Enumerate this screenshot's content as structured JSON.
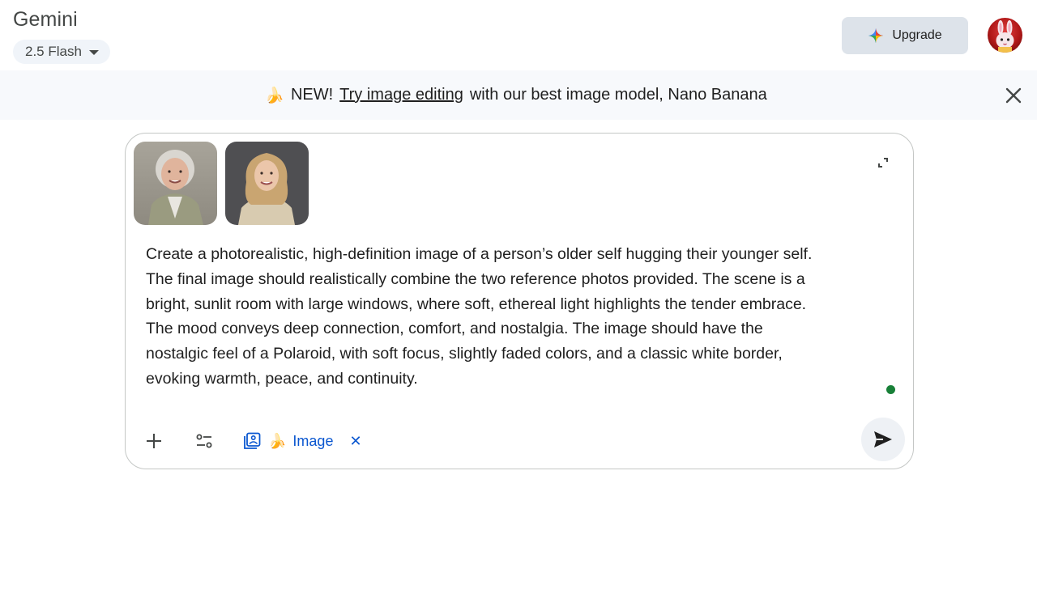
{
  "header": {
    "app_title": "Gemini",
    "model_label": "2.5 Flash",
    "upgrade_label": "Upgrade"
  },
  "banner": {
    "emoji": "🍌",
    "prefix": "NEW!",
    "link_text": "Try image editing",
    "suffix": "with our best image model, Nano Banana"
  },
  "composer": {
    "prompt": "Create a photorealistic, high-definition image of a person’s older self hugging their younger self.\nThe final image should realistically combine the two reference photos provided. The scene is a\nbright, sunlit room with large windows, where soft, ethereal light highlights the tender embrace.\nThe mood conveys deep connection, comfort, and nostalgia. The image should have the\nnostalgic feel of a Polaroid, with soft focus, slightly faded colors, and a classic white border,\nevoking warmth, peace, and continuity.",
    "chip_emoji": "🍌",
    "chip_label": "Image",
    "chip_close": "✕"
  },
  "colors": {
    "accent": "#0b57d0",
    "status_dot": "#188038",
    "banner_bg": "#f7f9fc",
    "upgrade_bg": "#dde3ea"
  },
  "icons": {
    "upgrade": "sparkle-icon",
    "banner_close": "close-icon",
    "expand": "expand-icon",
    "add": "plus-icon",
    "tools": "tools-icon",
    "image_chip": "image-gallery-icon",
    "send": "send-icon"
  }
}
